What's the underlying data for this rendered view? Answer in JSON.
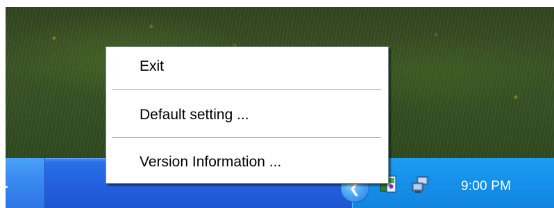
{
  "context_menu": {
    "items": [
      {
        "label": "Exit"
      },
      {
        "label": "Default setting ..."
      },
      {
        "label": "Version Information ..."
      }
    ]
  },
  "taskbar": {
    "clock": "9:00 PM",
    "tray_icons": [
      "show-hidden-icons-chevron",
      "app-tray-icon",
      "network-icon"
    ],
    "colors": {
      "taskbar": "#225fdc",
      "tray": "#1590ea",
      "menu_bg": "#ffffff"
    }
  }
}
